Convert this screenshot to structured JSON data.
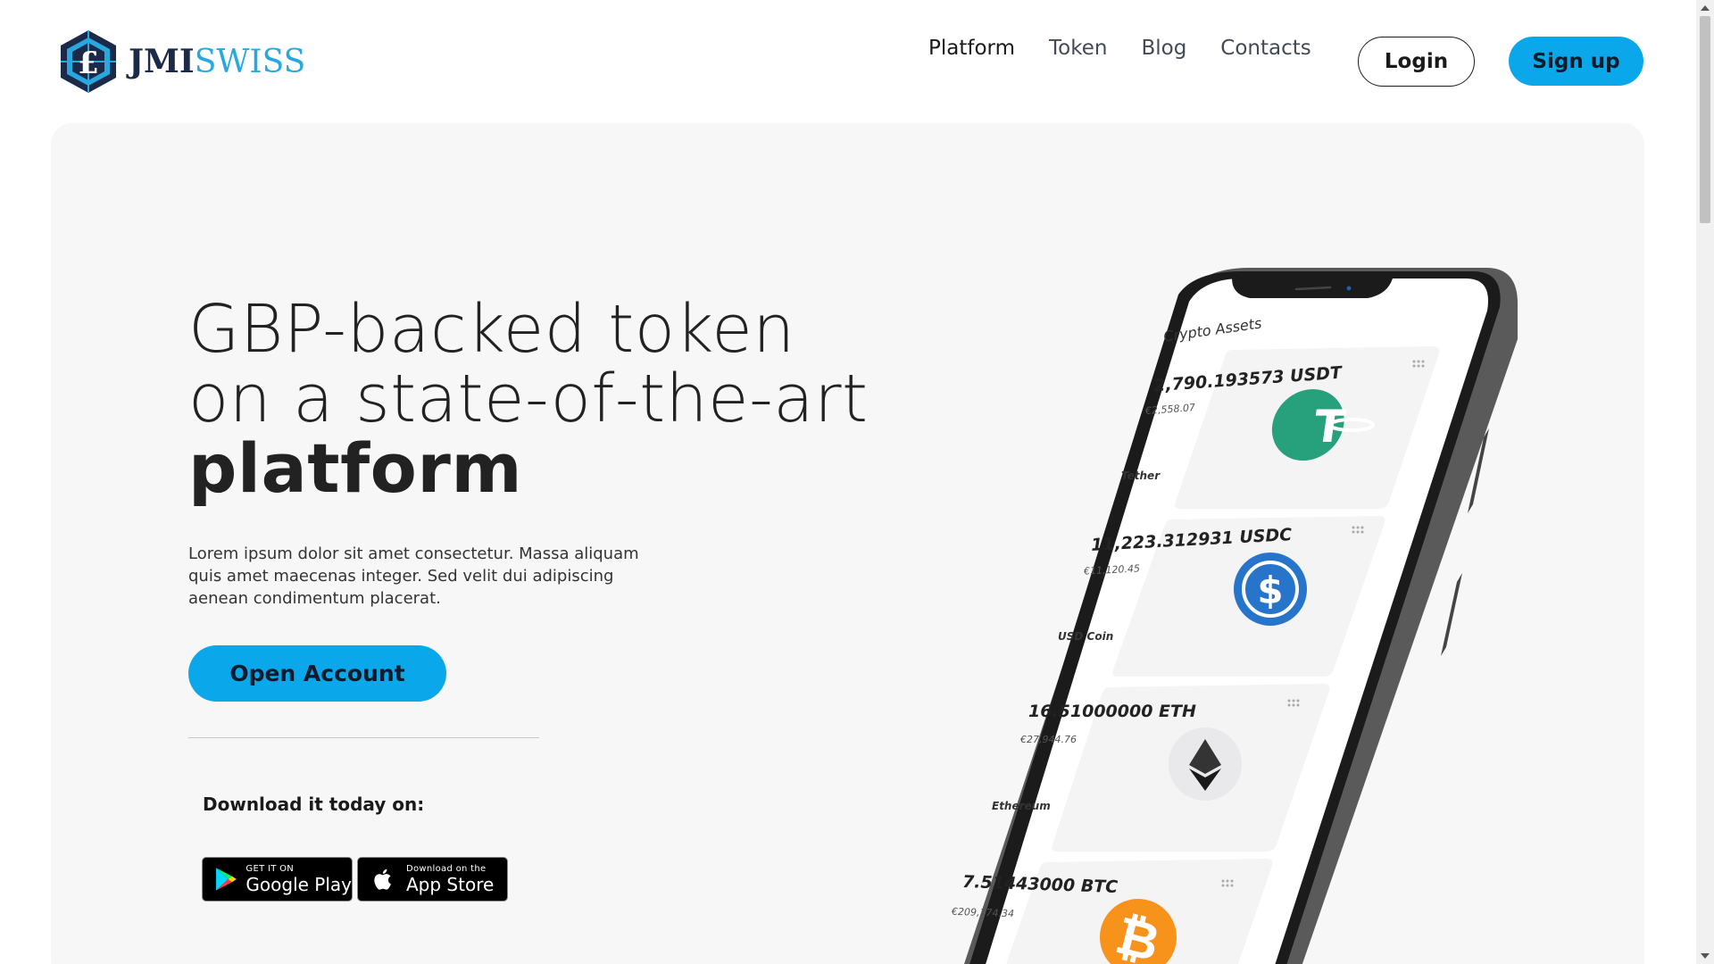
{
  "brand": {
    "name_part1": "JMI",
    "name_part2": "SWISS"
  },
  "nav": {
    "items": [
      {
        "label": "Platform",
        "active": true
      },
      {
        "label": "Token",
        "active": false
      },
      {
        "label": "Blog",
        "active": false
      },
      {
        "label": "Contacts",
        "active": false
      }
    ],
    "login_label": "Login",
    "signup_label": "Sign up"
  },
  "hero": {
    "headline_line1": "GBP-backed token",
    "headline_line2": "on a state-of-the-art",
    "headline_line3": "platform",
    "description": "Lorem ipsum dolor sit amet consectetur. Massa aliquam quis amet maecenas integer. Sed velit dui adipiscing aenean condimentum placerat.",
    "cta_label": "Open Account",
    "download_label": "Download it today on:",
    "google_play": {
      "small": "GET IT ON",
      "big": "Google Play"
    },
    "app_store": {
      "small": "Download on the",
      "big": "App Store"
    }
  },
  "phone": {
    "screen_title": "Crypto Assets",
    "assets": [
      {
        "amount": "2,790.193573 USDT",
        "fiat": "€2,558.07",
        "name": "Tether",
        "icon": "tether-icon"
      },
      {
        "amount": "11,223.312931 USDC",
        "fiat": "€11,120.45",
        "name": "USD Coin",
        "icon": "usdc-icon"
      },
      {
        "amount": "16.51000000 ETH",
        "fiat": "€27,944.76",
        "name": "Ethereum",
        "icon": "ethereum-icon"
      },
      {
        "amount": "7.51443000 BTC",
        "fiat": "€209,174.34",
        "name": "",
        "icon": "bitcoin-icon"
      }
    ]
  },
  "colors": {
    "accent": "#0aa8ea",
    "brand_dark": "#1c2a4a",
    "brand_light": "#29a8e0",
    "hero_bg": "#f7f7f8"
  }
}
